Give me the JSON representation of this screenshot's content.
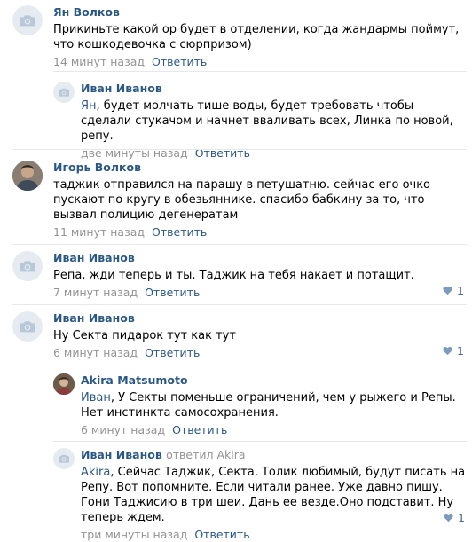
{
  "comments": [
    {
      "author": "Ян Волков",
      "text": "Прикиньте какой ор будет в отделении, когда жандармы поймут, что кошкодевочка с сюрпризом)",
      "time": "14 минут назад",
      "reply": "Ответить"
    },
    {
      "author": "Иван Иванов",
      "mention": "Ян",
      "text": ", будет молчать тише воды, будет требовать чтобы сделали стукачом и начнет вваливать всех, Линка по новой, репу.",
      "time": "две минуты назад",
      "reply": "Ответить"
    },
    {
      "author": "Игорь Волков",
      "text": "таджик отправился на парашу в петушатню. сейчас его очко пускают по кругу в обезьяннике. спасибо бабкину за то, что вызвал полицию дегенератам",
      "time": "11 минут назад",
      "reply": "Ответить"
    },
    {
      "author": "Иван Иванов",
      "text": "Репа, жди теперь и ты. Таджик на тебя накает и потащит.",
      "time": "7 минут назад",
      "reply": "Ответить",
      "likes": "1"
    },
    {
      "author": "Иван Иванов",
      "text": "Ну Секта пидарок тут как тут",
      "time": "6 минут назад",
      "reply": "Ответить",
      "likes": "1"
    },
    {
      "author": "Akira Matsumoto",
      "mention": "Иван",
      "text": ", У Секты поменьше ограничений, чем у рыжего и Репы. Нет инстинкта самосохранения.",
      "time": "6 минут назад",
      "reply": "Ответить"
    },
    {
      "author": "Иван Иванов",
      "replied_to": "ответил Akira",
      "mention": "Akira",
      "text": ", Сейчас Таджик, Секта, Толик любимый, будут писать на Репу. Вот попомните. Если читали ранее. Уже давно пишу. Гони Таджисию в три шеи. Дань ее везде.Оно подставит. Ну теперь ждем.",
      "time": "три минуты назад",
      "reply": "Ответить",
      "likes": "1"
    }
  ],
  "icons": {
    "placeholder_avatar": "camera-icon",
    "like": "heart-icon"
  },
  "colors": {
    "link": "#2a5885",
    "meta": "#939393",
    "avatar_placeholder": "#e5ebf1"
  }
}
